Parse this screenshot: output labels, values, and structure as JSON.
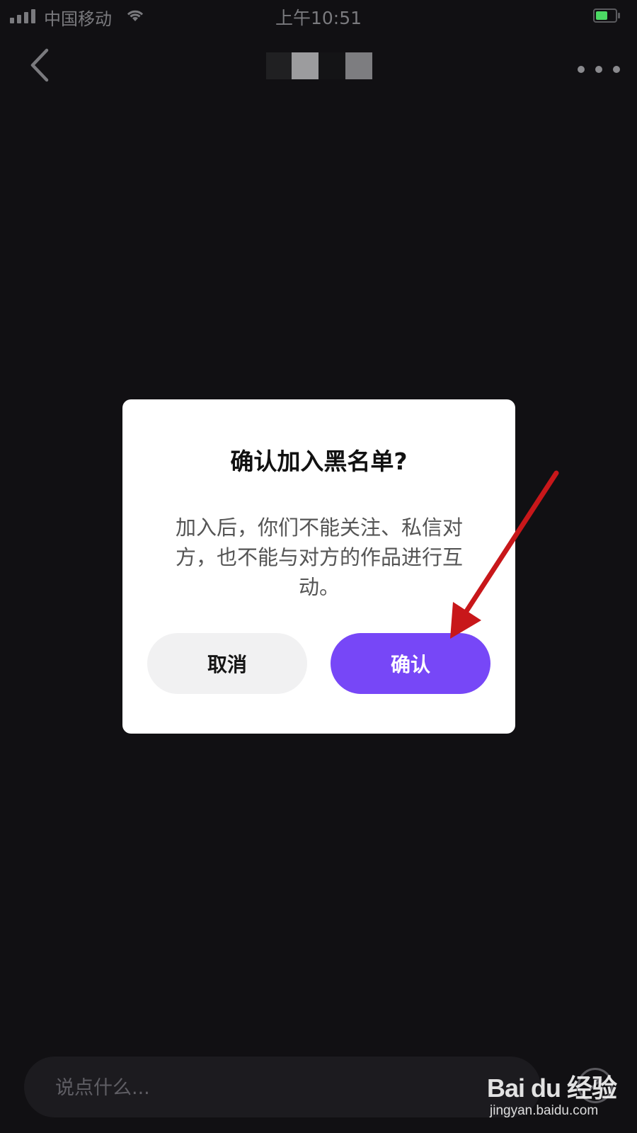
{
  "status_bar": {
    "carrier": "中国移动",
    "time": "上午10:51",
    "battery_level": 0.6,
    "battery_color": "#4cd964"
  },
  "nav": {
    "back_icon": "chevron-left-icon",
    "more_icon": "ellipsis-icon"
  },
  "dialog": {
    "title": "确认加入黑名单?",
    "message": "加入后，你们不能关注、私信对方，也不能与对方的作品进行互动。",
    "cancel_label": "取消",
    "confirm_label": "确认",
    "confirm_color": "#7747f7"
  },
  "comment_bar": {
    "placeholder": "说点什么..."
  },
  "watermark": {
    "logo": "Bai du 经验",
    "url": "jingyan.baidu.com"
  },
  "annotation": {
    "arrow_color": "#c8171a"
  }
}
